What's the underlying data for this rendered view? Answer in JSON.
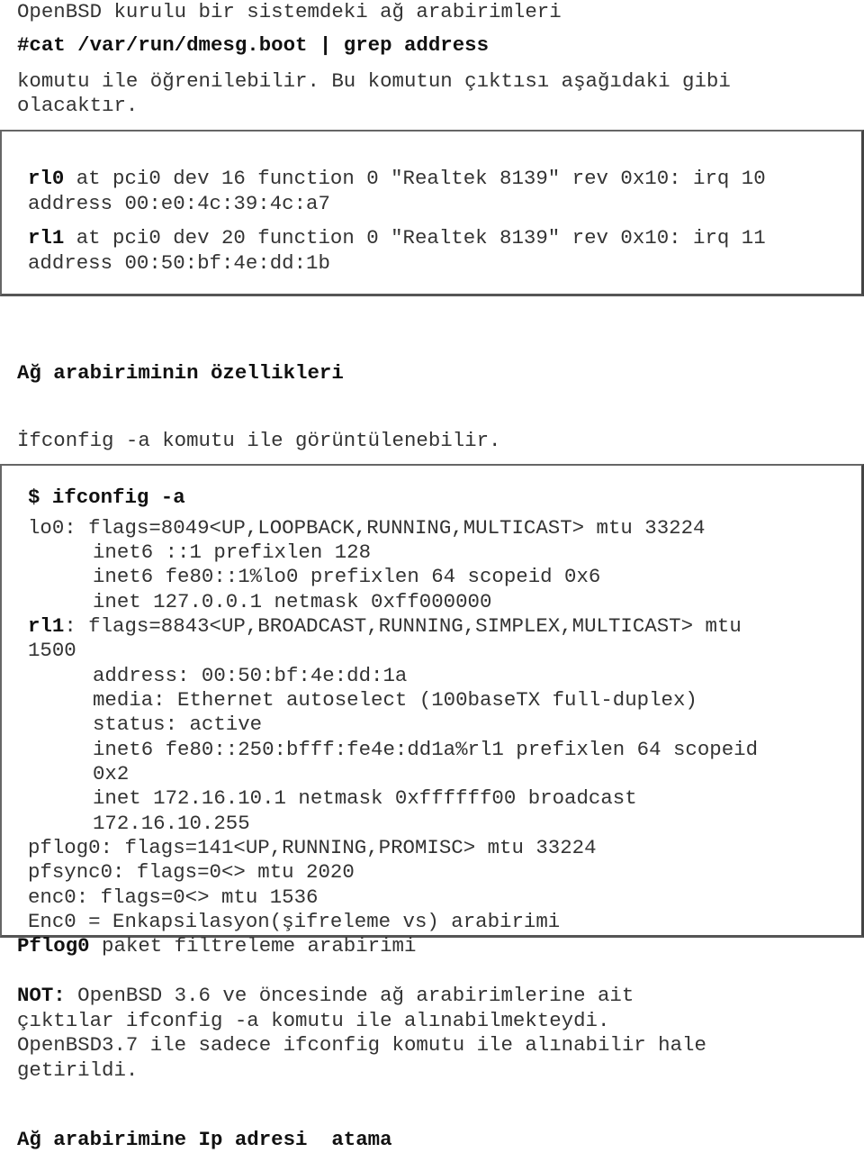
{
  "intro": {
    "line1": "OpenBSD kurulu bir sistemdeki ağ arabirimleri",
    "command": "#cat /var/run/dmesg.boot | grep address",
    "line2": "komutu ile öğrenilebilir. Bu komutun çıktısı aşağıdaki gibi",
    "line3": "olacaktır."
  },
  "dmesg_box": {
    "entries": [
      {
        "name": "rl0",
        "rest": " at pci0 dev 16 function 0 \"Realtek 8139\" rev 0x10: irq 10",
        "address": "address 00:e0:4c:39:4c:a7"
      },
      {
        "name": "rl1",
        "rest": " at pci0 dev 20 function 0 \"Realtek 8139\" rev 0x10: irq 11",
        "address": "address 00:50:bf:4e:dd:1b"
      }
    ]
  },
  "section1": {
    "heading": "Ağ arabiriminin özellikleri",
    "text": "İfconfig -a komutu ile görüntülenebilir."
  },
  "ifconfig_box": {
    "prompt": "$ ifconfig -a",
    "lo0": {
      "name": "lo0:",
      "flags": " flags=8049<UP,LOOPBACK,RUNNING,MULTICAST> mtu 33224",
      "l1": "inet6 ::1 prefixlen 128",
      "l2": "inet6 fe80::1%lo0 prefixlen 64 scopeid 0x6",
      "l3": "inet 127.0.0.1 netmask 0xff000000"
    },
    "rl1": {
      "name": "rl1",
      "flags": ": flags=8843<UP,BROADCAST,RUNNING,SIMPLEX,MULTICAST> mtu",
      "wrap": "1500",
      "l1": "address: 00:50:bf:4e:dd:1a",
      "l2": "media: Ethernet autoselect (100baseTX full-duplex)",
      "l3": "status: active",
      "l4": "inet6 fe80::250:bfff:fe4e:dd1a%rl1 prefixlen 64 scopeid",
      "l5": "0x2",
      "l6": "inet 172.16.10.1 netmask 0xffffff00 broadcast",
      "l7": "172.16.10.255"
    },
    "pflog0": "pflog0: flags=141<UP,RUNNING,PROMISC> mtu 33224",
    "pfsync0": "pfsync0: flags=0<> mtu 2020",
    "enc0": "enc0: flags=0<> mtu 1536",
    "enc_note": "Enc0 = Enkapsilasyon(şifreleme vs) arabirimi"
  },
  "pflog_note": {
    "name": "Pflog0",
    "text": " paket filtreleme arabirimi"
  },
  "note": {
    "label": "NOT:",
    "l1": " OpenBSD 3.6 ve öncesinde ağ arabirimlerine ait",
    "l2": "çıktılar ifconfig -a komutu ile alınabilmekteydi.",
    "l3": "OpenBSD3.7 ile sadece ifconfig komutu ile alınabilir hale",
    "l4": "getirildi."
  },
  "section2": {
    "heading": "Ağ arabirimine Ip adresi  atama"
  }
}
